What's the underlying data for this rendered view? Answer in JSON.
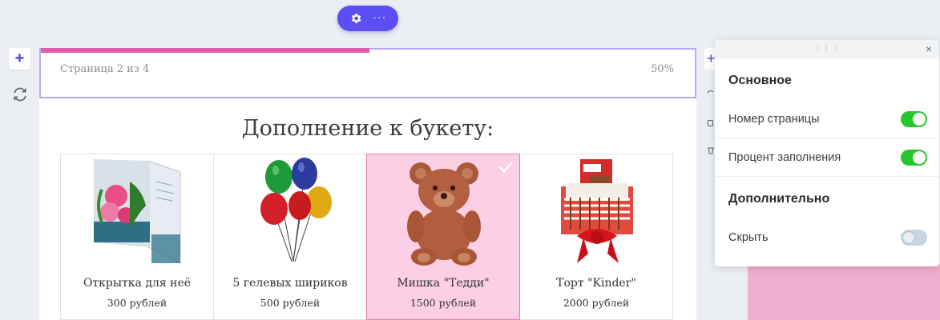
{
  "toolbar": {
    "gear_icon": "gear-icon",
    "more_icon": "more-dots-icon",
    "more_label": "···"
  },
  "left_tools": {
    "add_label": "+",
    "refresh_icon": "refresh-icon"
  },
  "progress": {
    "page_text": "Страница 2 из 4",
    "percent_text": "50%",
    "percent_value": 50,
    "fill_color": "#e05bab"
  },
  "section": {
    "title": "Дополнение к букету:"
  },
  "items": [
    {
      "name": "Открытка для неё",
      "price": "300 рублей",
      "icon": "greeting-card-image",
      "selected": false
    },
    {
      "name": "5 гелевых шириков",
      "price": "500 рублей",
      "icon": "balloons-image",
      "selected": false
    },
    {
      "name": "Мишка \"Тедди\"",
      "price": "1500 рублей",
      "icon": "teddy-bear-image",
      "selected": true
    },
    {
      "name": "Торт \"Kinder\"",
      "price": "2000 рублей",
      "icon": "kinder-cake-image",
      "selected": false
    }
  ],
  "panel": {
    "drag_icon": "drag-handle-icon",
    "drag_label": "⋮⋮⋮",
    "close_label": "×",
    "basic_title": "Основное",
    "page_number_label": "Номер страницы",
    "page_number_on": true,
    "fill_percent_label": "Процент заполнения",
    "fill_percent_on": true,
    "extra_title": "Дополнительно",
    "hide_label": "Скрыть",
    "hide_on": false
  },
  "colors": {
    "accent": "#5b4ef5",
    "selected_bg": "#fccfe5",
    "toggle_on": "#25c72c"
  }
}
